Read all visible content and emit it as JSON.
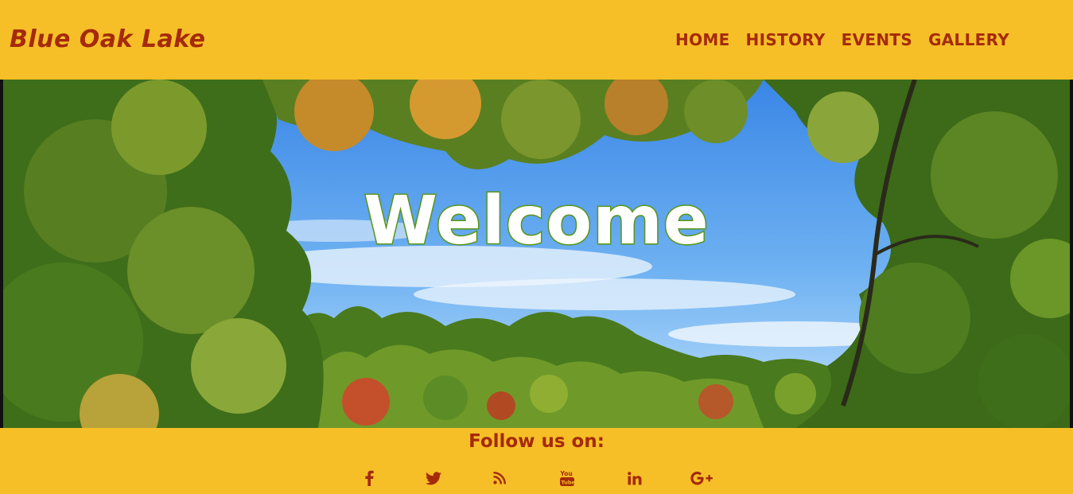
{
  "header": {
    "brand": "Blue Oak Lake",
    "nav": [
      "HOME",
      "HISTORY",
      "EVENTS",
      "GALLERY"
    ]
  },
  "hero": {
    "heading": "Welcome"
  },
  "footer": {
    "follow_label": "Follow us on:",
    "social_icons": [
      "facebook-icon",
      "twitter-icon",
      "rss-icon",
      "youtube-icon",
      "linkedin-icon",
      "google-plus-icon"
    ]
  },
  "colors": {
    "background": "#f6bf27",
    "text_accent": "#a52a0a",
    "welcome_outline": "#5e9b1c"
  }
}
